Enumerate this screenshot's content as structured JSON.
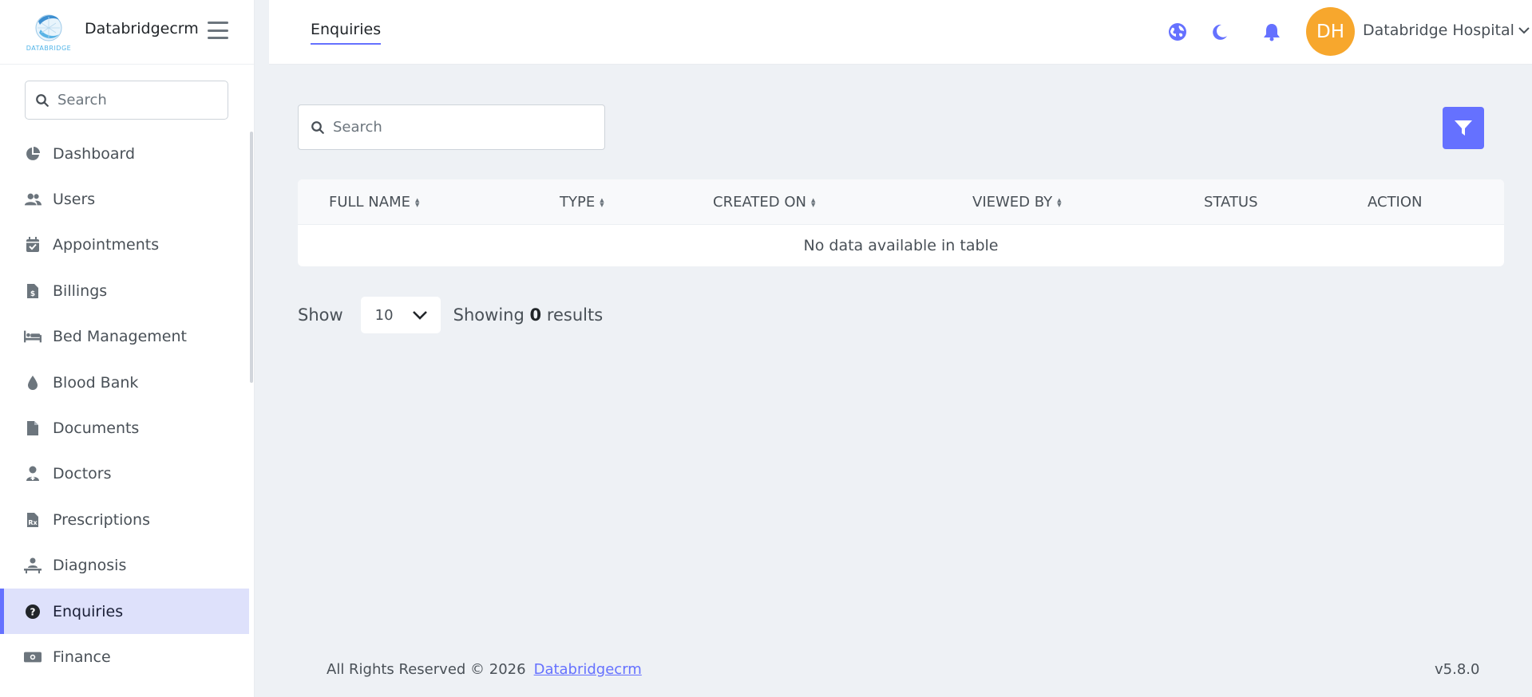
{
  "brand": {
    "name": "Databridgecrm",
    "logo_text": "DATABRIDGE"
  },
  "sidebar": {
    "search_placeholder": "Search",
    "items": [
      {
        "label": "Dashboard",
        "icon": "chart-pie-icon"
      },
      {
        "label": "Users",
        "icon": "users-icon"
      },
      {
        "label": "Appointments",
        "icon": "calendar-check-icon"
      },
      {
        "label": "Billings",
        "icon": "invoice-dollar-icon"
      },
      {
        "label": "Bed Management",
        "icon": "bed-icon"
      },
      {
        "label": "Blood Bank",
        "icon": "droplet-icon"
      },
      {
        "label": "Documents",
        "icon": "file-icon"
      },
      {
        "label": "Doctors",
        "icon": "user-doctor-icon"
      },
      {
        "label": "Prescriptions",
        "icon": "file-prescription-icon"
      },
      {
        "label": "Diagnosis",
        "icon": "diagnosis-icon"
      },
      {
        "label": "Enquiries",
        "icon": "question-circle-icon",
        "active": true
      },
      {
        "label": "Finance",
        "icon": "money-bill-icon"
      }
    ]
  },
  "header": {
    "tab": "Enquiries",
    "avatar_initials": "DH",
    "user_name": "Databridge Hospital",
    "accent_color": "#6571ff",
    "avatar_color": "#f7a72d"
  },
  "main": {
    "search_placeholder": "Search",
    "table": {
      "columns": [
        "FULL NAME",
        "TYPE",
        "CREATED ON",
        "VIEWED BY",
        "STATUS",
        "ACTION"
      ],
      "empty_text": "No data available in table"
    },
    "pagination": {
      "show_label": "Show",
      "page_size": "10",
      "results_prefix": "Showing",
      "results_count": "0",
      "results_suffix": "results"
    }
  },
  "footer": {
    "copyright": "All Rights Reserved © 2026",
    "link": "Databridgecrm",
    "version": "v5.8.0"
  }
}
